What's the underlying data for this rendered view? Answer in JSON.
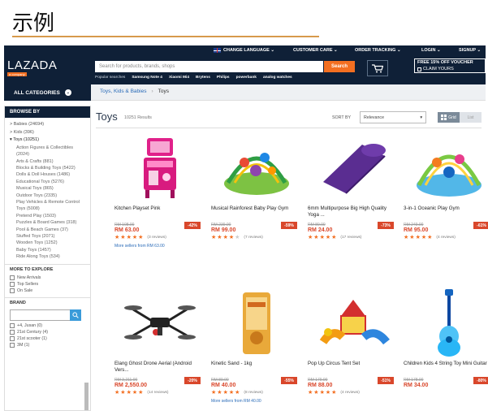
{
  "slide": {
    "title": "示例"
  },
  "topbar": {
    "change_language": "CHANGE LANGUAGE ⌄",
    "customer_care": "CUSTOMER CARE ⌄",
    "order_tracking": "ORDER TRACKING ⌄",
    "login": "LOGIN ⌄",
    "signup": "SIGNUP ⌄"
  },
  "header": {
    "logo": "LAZADA",
    "logo_sub": "a company",
    "search_placeholder": "Search for products, brands, shops",
    "search_button": "Search",
    "popular_label": "Popular searches",
    "popular": [
      "Samsung Note 4",
      "Xiaomi Mi4",
      "Brytens",
      "Philips",
      "powerbank",
      "analog watches"
    ],
    "voucher_line1": "FREE 15% OFF VOUCHER",
    "voucher_line2": "CLAIM YOURS"
  },
  "nav": {
    "all_categories": "ALL CATEGORIES",
    "breadcrumb": [
      "Toys, Kids & Babies",
      "Toys"
    ]
  },
  "sidebar": {
    "browse_by": "BROWSE BY",
    "categories": [
      {
        "label": "> Babies (24694)",
        "level": 0
      },
      {
        "label": "> Kids (396)",
        "level": 0
      },
      {
        "label": "▾ Toys (10251)",
        "level": 0
      },
      {
        "label": "Action Figures & Collectibles (2024)",
        "level": 1
      },
      {
        "label": "Arts & Crafts (881)",
        "level": 1
      },
      {
        "label": "Blocks & Building Toys (5422)",
        "level": 1
      },
      {
        "label": "Dolls & Doll Houses (1486)",
        "level": 1
      },
      {
        "label": "Educational Toys (5276)",
        "level": 1
      },
      {
        "label": "Musical Toys (865)",
        "level": 1
      },
      {
        "label": "Outdoor Toys (2335)",
        "level": 1
      },
      {
        "label": "Play Vehicles & Remote Control Toys (5008)",
        "level": 1
      },
      {
        "label": "Pretend Play (1503)",
        "level": 1
      },
      {
        "label": "Puzzles & Board Games (318)",
        "level": 1
      },
      {
        "label": "Pool & Beach Games (37)",
        "level": 1
      },
      {
        "label": "Stuffed Toys (2071)",
        "level": 1
      },
      {
        "label": "Wooden Toys (1252)",
        "level": 1
      },
      {
        "label": "Baby Toys (1457)",
        "level": 1
      },
      {
        "label": "Ride Along Toys (534)",
        "level": 1
      }
    ],
    "more_to_explore": "MORE TO EXPLORE",
    "explore": [
      "New Arrivals",
      "Top Sellers",
      "On Sale"
    ],
    "brand": "BRAND",
    "brands": [
      "+4, Jusan (0)",
      "21st Century (4)",
      "21st scooter (1)",
      "3M (1)"
    ]
  },
  "main": {
    "title": "Toys",
    "results": "10251 Results",
    "sort_by": "SORT BY",
    "sort_value": "Relevance",
    "view_grid": "Grid",
    "view_list": "List"
  },
  "products": [
    {
      "name": "Kitchen Playset Pink",
      "old_price": "RM 108.00",
      "price": "RM 63.00",
      "discount": "-42%",
      "stars": 5,
      "reviews": "(3 reviews)",
      "more": "More sellers from RM 63.00"
    },
    {
      "name": "Musical Rainforest Baby Play Gym",
      "old_price": "RM 239.00",
      "price": "RM 99.00",
      "discount": "-59%",
      "stars": 4,
      "reviews": "(7 reviews)",
      "more": ""
    },
    {
      "name": "6mm Multipurpose Big High Quality Yoga ...",
      "old_price": "RM 89.00",
      "price": "RM 24.00",
      "discount": "-73%",
      "stars": 5,
      "reviews": "(17 reviews)",
      "more": ""
    },
    {
      "name": "3-in-1 Oceanic Play Gym",
      "old_price": "RM 249.00",
      "price": "RM 95.00",
      "discount": "-61%",
      "stars": 5,
      "reviews": "(4 reviews)",
      "more": ""
    },
    {
      "name": "Elang Ghost Drone Aerial (Android Vers...",
      "old_price": "RM 3,211.00",
      "price": "RM 2,550.00",
      "discount": "-20%",
      "stars": 5,
      "reviews": "(14 reviews)",
      "more": ""
    },
    {
      "name": "Kinetic Sand - 1kg",
      "old_price": "RM 89.00",
      "price": "RM 40.00",
      "discount": "-55%",
      "stars": 5,
      "reviews": "(8 reviews)",
      "more": "More sellers from RM 40.00"
    },
    {
      "name": "Pop Up Circus Tent Set",
      "old_price": "RM 179.00",
      "price": "RM 88.00",
      "discount": "-51%",
      "stars": 5,
      "reviews": "(4 reviews)",
      "more": ""
    },
    {
      "name": "Children Kids 4 String Toy Mini Guitar ...",
      "old_price": "RM 178.00",
      "price": "RM 34.00",
      "discount": "-80%",
      "stars": 0,
      "reviews": "",
      "more": ""
    }
  ],
  "colors": {
    "header_bg": "#0f2037",
    "accent": "#f36f21",
    "price_red": "#d9472b",
    "link_blue": "#2a6bb8"
  },
  "icons": [
    "flag-icon",
    "cart-icon",
    "chevron-down-icon",
    "grid-view-icon",
    "search-icon",
    "star-icon"
  ]
}
